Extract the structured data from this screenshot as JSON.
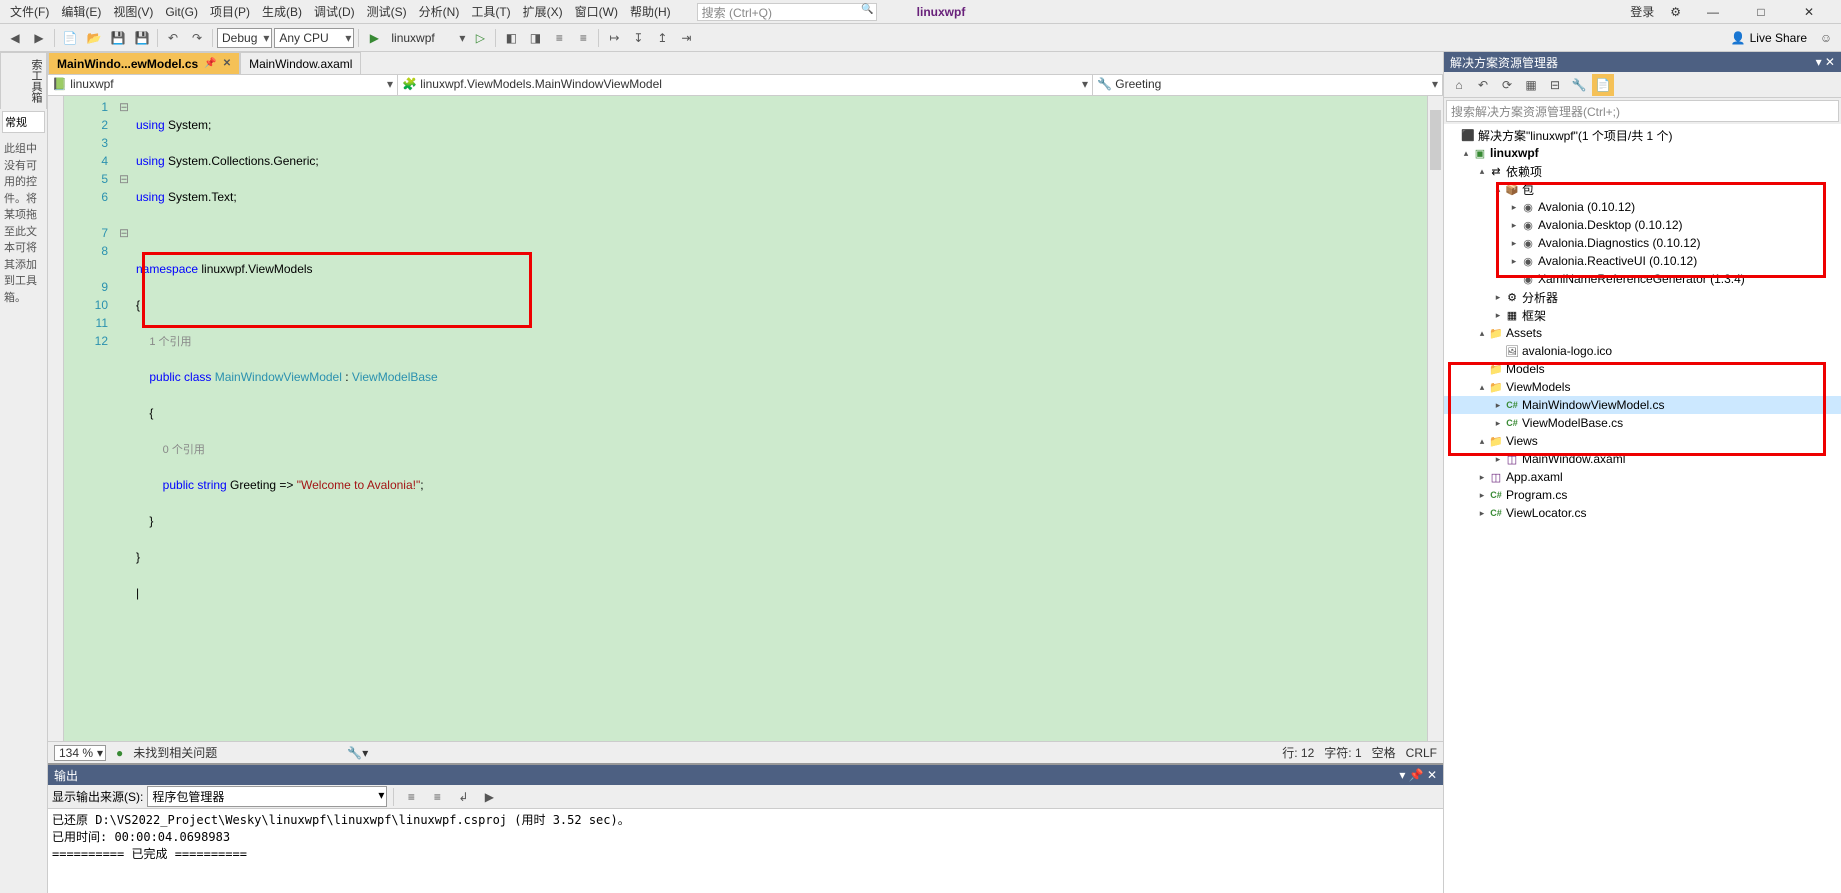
{
  "menu": {
    "items": [
      "文件(F)",
      "编辑(E)",
      "视图(V)",
      "Git(G)",
      "项目(P)",
      "生成(B)",
      "调试(D)",
      "测试(S)",
      "分析(N)",
      "工具(T)",
      "扩展(X)",
      "窗口(W)",
      "帮助(H)"
    ],
    "search_placeholder": "搜索 (Ctrl+Q)",
    "title_project": "linuxwpf",
    "login": "登录",
    "live_share": "Live Share"
  },
  "toolbar": {
    "config": "Debug",
    "platform": "Any CPU",
    "start_target": "linuxwpf"
  },
  "tabs": {
    "active": "MainWindo...ewModel.cs",
    "other": "MainWindow.axaml"
  },
  "nav": {
    "project": "linuxwpf",
    "class": "linuxwpf.ViewModels.MainWindowViewModel",
    "member": "Greeting"
  },
  "code": {
    "line1": "using System;",
    "line2": "using System.Collections.Generic;",
    "line3": "using System.Text;",
    "line5a": "namespace ",
    "line5b": "linuxwpf.ViewModels",
    "ref1": "1 个引用",
    "line7a": "public class ",
    "line7b": "MainWindowViewModel",
    "line7c": " : ",
    "line7d": "ViewModelBase",
    "ref0": "0 个引用",
    "line9a": "public string ",
    "line9b": "Greeting => ",
    "line9c": "\"Welcome to Avalonia!\"",
    "line9d": ";"
  },
  "status": {
    "zoom": "134 %",
    "issues": "未找到相关问题",
    "line": "行: 12",
    "col": "字符: 1",
    "spaces": "空格",
    "crlf": "CRLF"
  },
  "output": {
    "title": "输出",
    "source_label": "显示输出来源(S):",
    "source_value": "程序包管理器",
    "body": "已还原 D:\\VS2022_Project\\Wesky\\linuxwpf\\linuxwpf\\linuxwpf.csproj (用时 3.52 sec)。\n已用时间: 00:00:04.0698983\n========== 已完成 ==========\n"
  },
  "solution": {
    "title": "解决方案资源管理器",
    "search_placeholder": "搜索解决方案资源管理器(Ctrl+;)",
    "sln": "解决方案\"linuxwpf\"(1 个项目/共 1 个)",
    "project": "linuxwpf",
    "deps": "依赖项",
    "pkg": "包",
    "packages": [
      "Avalonia (0.10.12)",
      "Avalonia.Desktop (0.10.12)",
      "Avalonia.Diagnostics (0.10.12)",
      "Avalonia.ReactiveUI (0.10.12)",
      "XamlNameReferenceGenerator (1.3.4)"
    ],
    "analyzer": "分析器",
    "framework": "框架",
    "assets": "Assets",
    "asset0": "avalonia-logo.ico",
    "models": "Models",
    "viewmodels": "ViewModels",
    "vm0": "MainWindowViewModel.cs",
    "vm1": "ViewModelBase.cs",
    "views": "Views",
    "view0": "MainWindow.axaml",
    "appaxaml": "App.axaml",
    "program": "Program.cs",
    "viewlocator": "ViewLocator.cs"
  }
}
